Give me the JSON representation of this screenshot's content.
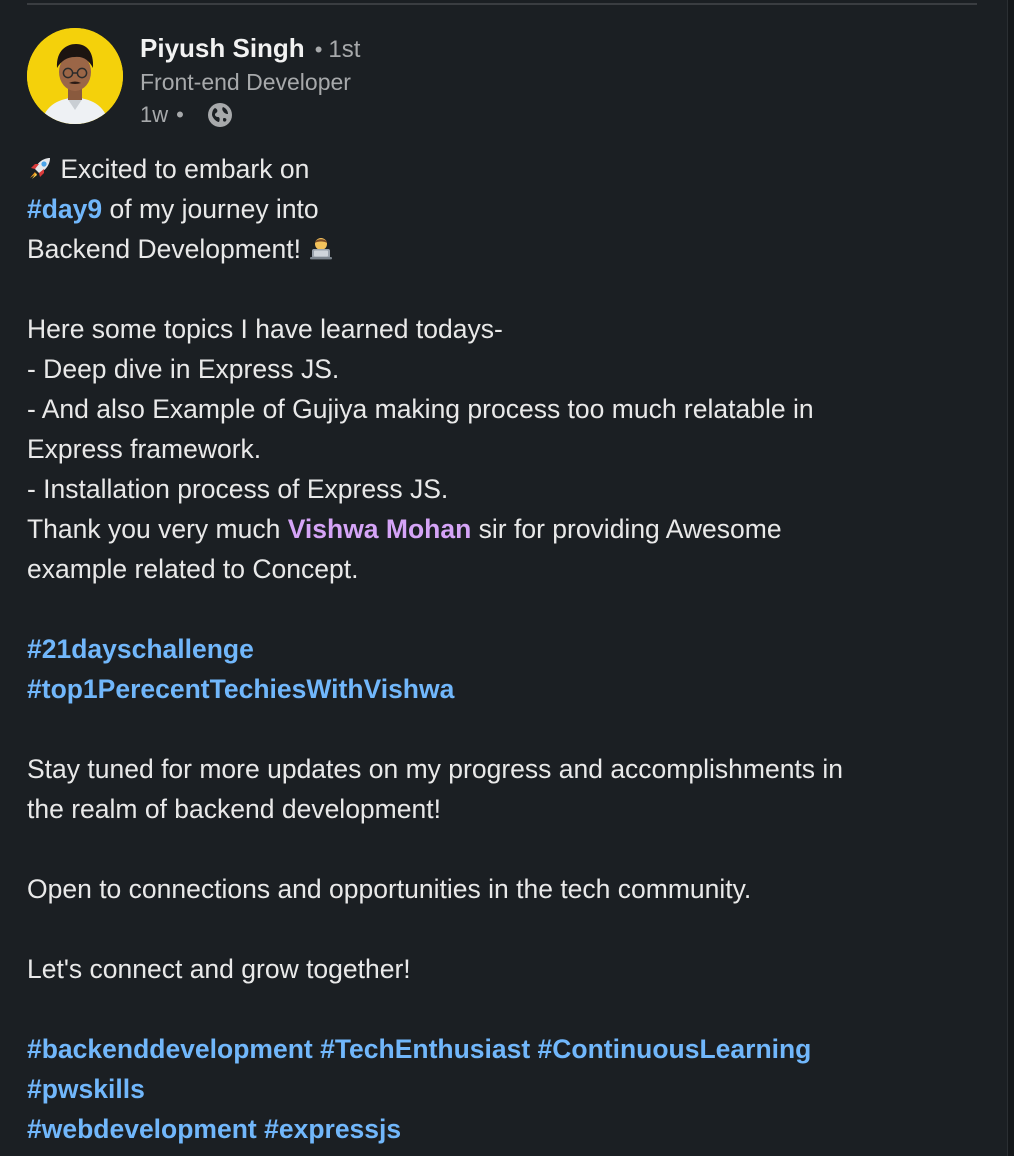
{
  "post": {
    "author": {
      "name": "Piyush Singh",
      "connection_sep": "•",
      "connection_degree": "1st",
      "headline": "Front-end Developer",
      "time_ago": "1w",
      "meta_sep": "•",
      "visibility_icon": "globe-icon"
    },
    "body": {
      "l1_text": "Excited to embark on",
      "l2_tag": "#day9",
      "l2_text": " of my journey into",
      "l3_text": "Backend Development! ",
      "l4_text": "Here some topics I have learned todays-",
      "l5_text": "- Deep dive in Express JS.",
      "l6_text": "- And also Example of Gujiya making process too much relatable in",
      "l7_text": "Express framework.",
      "l8_text": "- Installation process of Express JS.",
      "l9_pre": "Thank you very much ",
      "l9_mention": "Vishwa Mohan",
      "l9_post": " sir for providing Awesome",
      "l10_text": "example related to Concept.",
      "tag_21day": "#21dayschallenge",
      "tag_top1": "#top1PerecentTechiesWithVishwa",
      "l13_text": "Stay tuned for more updates on my progress and accomplishments in",
      "l14_text": "the realm of backend development!",
      "l15_text": "Open to connections and opportunities in the tech community.",
      "l16_text": "Let's connect and grow together!",
      "tag_backend": "#backenddevelopment",
      "tag_tech": "#TechEnthusiast",
      "tag_learning": "#ContinuousLearning",
      "tag_pwskills": "#pwskills",
      "tag_webdev": "#webdevelopment",
      "tag_express": "#expressjs"
    },
    "icons": {
      "rocket": "rocket-emoji-icon",
      "technologist": "technologist-emoji-icon"
    },
    "colors": {
      "background": "#1b1f23",
      "text": "#e9e9e9",
      "muted": "#a7a9ab",
      "hashtag": "#71b7fb",
      "mention": "#d5a4f7",
      "avatar_bg": "#f4d10b"
    }
  }
}
